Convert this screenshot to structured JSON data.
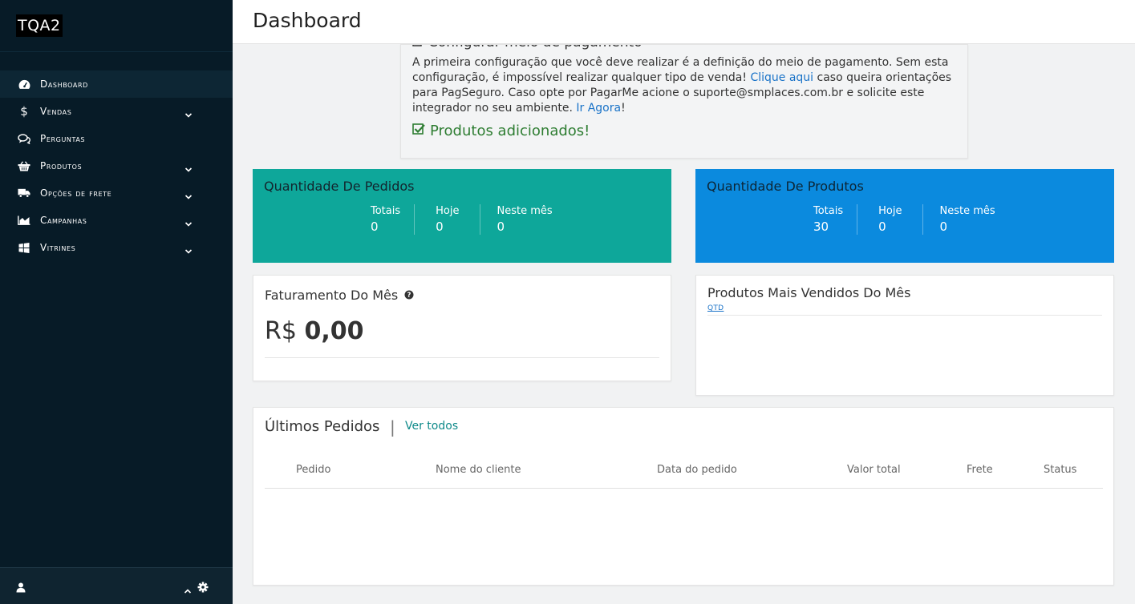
{
  "brand": {
    "name": "TQA2"
  },
  "sidebar": {
    "items": [
      {
        "label": "Dashboard",
        "icon": "dashboard-icon",
        "active": true,
        "has_submenu": false
      },
      {
        "label": "Vendas",
        "icon": "dollar-icon",
        "active": false,
        "has_submenu": true
      },
      {
        "label": "Perguntas",
        "icon": "comments-icon",
        "active": false,
        "has_submenu": false
      },
      {
        "label": "Produtos",
        "icon": "basket-icon",
        "active": false,
        "has_submenu": true
      },
      {
        "label": "Opções de frete",
        "icon": "truck-icon",
        "active": false,
        "has_submenu": true
      },
      {
        "label": "Campanhas",
        "icon": "area-chart-icon",
        "active": false,
        "has_submenu": true
      },
      {
        "label": "Vitrines",
        "icon": "windows-icon",
        "active": false,
        "has_submenu": true
      }
    ]
  },
  "header": {
    "title": "Dashboard"
  },
  "notice": {
    "clipped_heading": "Configurar meio de pagamento",
    "text_1": "A primeira configuração que você deve realizar é a definição do meio de pagamento. Sem esta configuração, é impossível realizar qualquer tipo de venda! ",
    "link_1": "Clique aqui",
    "text_2": " caso queira orientações para PagSeguro. Caso opte por PagarMe acione o suporte@smplaces.com.br e solicite este integrador no seu ambiente. ",
    "link_2": "Ir Agora",
    "text_3": "!",
    "done": "Produtos adicionados!"
  },
  "orders_stats": {
    "title": "Quantidade De Pedidos",
    "cols": [
      {
        "label": "Totais",
        "value": "0"
      },
      {
        "label": "Hoje",
        "value": "0"
      },
      {
        "label": "Neste mês",
        "value": "0"
      }
    ]
  },
  "products_stats": {
    "title": "Quantidade De Produtos",
    "cols": [
      {
        "label": "Totais",
        "value": "30"
      },
      {
        "label": "Hoje",
        "value": "0"
      },
      {
        "label": "Neste mês",
        "value": "0"
      }
    ]
  },
  "billing": {
    "title": "Faturamento Do Mês",
    "currency": "R$",
    "value": "0,00"
  },
  "top_products": {
    "title": "Produtos Mais Vendidos Do Mês",
    "column": "QTD"
  },
  "last_orders": {
    "title": "Últimos Pedidos",
    "separator": "|",
    "link": "Ver todos",
    "columns": [
      "Pedido",
      "Nome do cliente",
      "Data do pedido",
      "Valor total",
      "Frete",
      "Status"
    ]
  },
  "colors": {
    "sidebar": "#071b27",
    "green_card": "#0ea79a",
    "blue_card": "#0b8ade",
    "link": "#1a73c8"
  }
}
